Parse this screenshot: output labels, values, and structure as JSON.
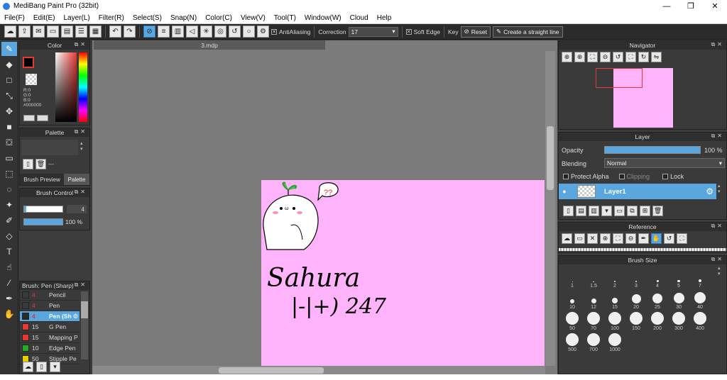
{
  "title": "MediBang Paint Pro (32bit)",
  "window_buttons": [
    "—",
    "❐",
    "✕"
  ],
  "menu": [
    "File(F)",
    "Edit(E)",
    "Layer(L)",
    "Filter(R)",
    "Select(S)",
    "Snap(N)",
    "Color(C)",
    "View(V)",
    "Tool(T)",
    "Window(W)",
    "Cloud",
    "Help"
  ],
  "toolbar": {
    "antialiasing": "AntiAliasing",
    "correction_label": "Correction",
    "correction_value": "17",
    "soft_edge": "Soft Edge",
    "key_label": "Key",
    "reset": "Reset",
    "straight_line": "Create a straight line"
  },
  "document_tab": "3.mdp",
  "color_panel": {
    "title": "Color",
    "r": "R:0",
    "g": "G:0",
    "b": "B:0",
    "hex": "#000000"
  },
  "palette_panel": {
    "title": "Palette",
    "count": "---",
    "tab_brush_preview": "Brush Preview",
    "tab_palette": "Palette"
  },
  "brush_control": {
    "title": "Brush Control",
    "size": "4",
    "opacity": "100 %",
    "opacity_fraction": 1.0
  },
  "brush_list": {
    "title": "Brush: Pen (Sharp)",
    "items": [
      {
        "size": "4",
        "name": "Pencil",
        "color": "#3a3a3a"
      },
      {
        "size": "4",
        "name": "Pen",
        "color": "#3a3a3a"
      },
      {
        "size": "4",
        "name": "Pen (Sh",
        "color": "#2a2a2a"
      },
      {
        "size": "15",
        "name": "G Pen",
        "color": "#e53935"
      },
      {
        "size": "15",
        "name": "Mapping P",
        "color": "#e53935"
      },
      {
        "size": "10",
        "name": "Edge Pen",
        "color": "#22aa22"
      },
      {
        "size": "50",
        "name": "Stipple Pe",
        "color": "#e8d000"
      }
    ]
  },
  "navigator": {
    "title": "Navigator"
  },
  "layer_panel": {
    "title": "Layer",
    "opacity_label": "Opacity",
    "opacity_value": "100 %",
    "opacity_fraction": 1.0,
    "blending_label": "Blending",
    "blending_value": "Normal",
    "protect_alpha": "Protect Alpha",
    "clipping": "Clipping",
    "lock": "Lock",
    "layer_name": "Layer1"
  },
  "reference_panel": {
    "title": "Reference"
  },
  "brush_size_panel": {
    "title": "Brush Size",
    "sizes": [
      "1",
      "1.5",
      "2",
      "3",
      "4",
      "5",
      "7",
      "10",
      "12",
      "15",
      "20",
      "25",
      "30",
      "40",
      "50",
      "70",
      "100",
      "150",
      "200",
      "300",
      "400",
      "500",
      "700",
      "1000"
    ]
  },
  "canvas_text": {
    "line1": "Sahura",
    "line2": "|-|+) 247"
  },
  "colors": {
    "accent": "#5aa7e0",
    "canvas_paper": "#ffb3fb",
    "workspace": "#7b7b7b",
    "panel_bg": "#3a3a3a"
  }
}
